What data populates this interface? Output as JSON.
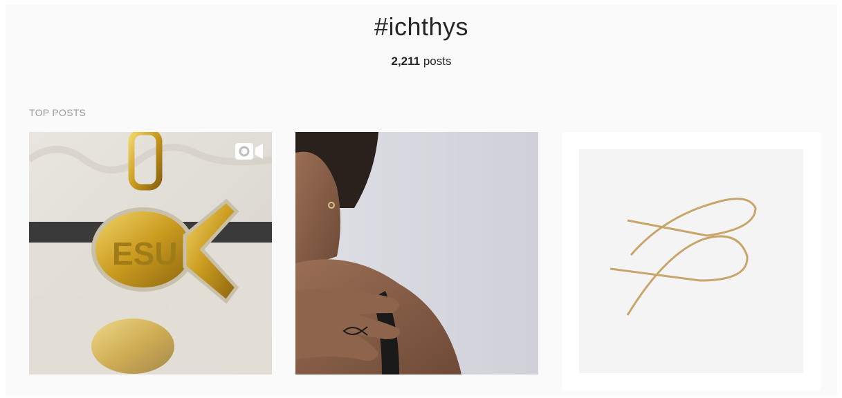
{
  "hashtag": {
    "title": "#ichthys",
    "post_count": "2,211",
    "post_label": "posts"
  },
  "sections": {
    "top_posts_label": "TOP POSTS"
  },
  "top_posts": [
    {
      "kind": "video",
      "icon": "video-camera-icon",
      "subject": "gold-fish-pendant"
    },
    {
      "kind": "photo",
      "subject": "shoulder-tattoo"
    },
    {
      "kind": "photo",
      "subject": "wire-fish-earring"
    }
  ]
}
